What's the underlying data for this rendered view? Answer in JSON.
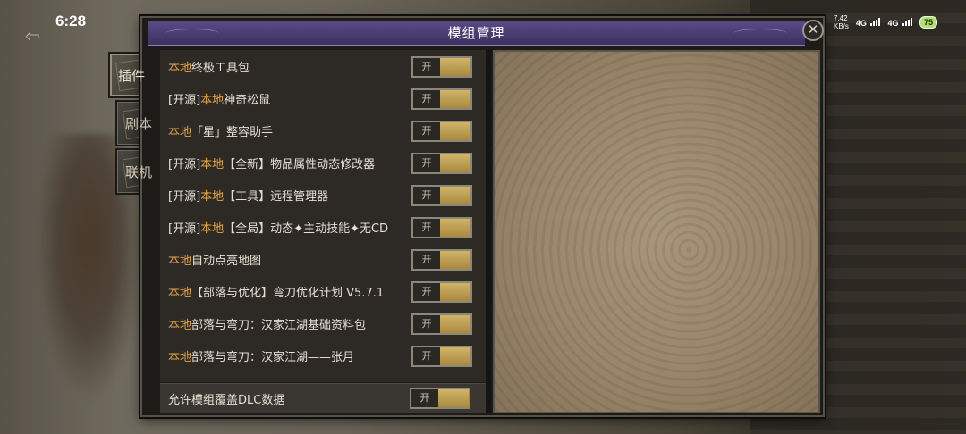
{
  "status_bar": {
    "time": "6:28",
    "speed_value": "7.42",
    "speed_unit": "KB/s",
    "net1": "4G",
    "net2": "4G",
    "battery": "75"
  },
  "side_tabs": [
    {
      "label": "插件",
      "active": true
    },
    {
      "label": "剧本",
      "active": false
    },
    {
      "label": "联机",
      "active": false
    }
  ],
  "dialog": {
    "title": "模组管理",
    "close_symbol": "✕"
  },
  "mods": [
    {
      "prefix": "",
      "highlight": "本地",
      "name": "终极工具包",
      "toggle": "开"
    },
    {
      "prefix": "[开源]",
      "highlight": "本地",
      "name": "神奇松鼠",
      "toggle": "开"
    },
    {
      "prefix": "",
      "highlight": "本地",
      "name": "「星」整容助手",
      "toggle": "开"
    },
    {
      "prefix": "[开源]",
      "highlight": "本地",
      "name": "【全新】物品属性动态修改器",
      "toggle": "开"
    },
    {
      "prefix": "[开源]",
      "highlight": "本地",
      "name": "【工具】远程管理器",
      "toggle": "开"
    },
    {
      "prefix": "[开源]",
      "highlight": "本地",
      "name": "【全局】动态✦主动技能✦无CD",
      "toggle": "开"
    },
    {
      "prefix": "",
      "highlight": "本地",
      "name": "自动点亮地图",
      "toggle": "开"
    },
    {
      "prefix": "",
      "highlight": "本地",
      "name": "【部落与优化】弯刀优化计划 V5.7.1",
      "toggle": "开"
    },
    {
      "prefix": "",
      "highlight": "本地",
      "name": "部落与弯刀：汉家江湖基础资料包",
      "toggle": "开"
    },
    {
      "prefix": "",
      "highlight": "本地",
      "name": "部落与弯刀：汉家江湖——张月",
      "toggle": "开"
    }
  ],
  "bottom_setting": {
    "label": "允许模组覆盖DLC数据",
    "toggle": "开"
  },
  "colors": {
    "highlight": "#e6a544",
    "title_bar": "#4a3d72",
    "toggle_on": "#c4a656"
  }
}
